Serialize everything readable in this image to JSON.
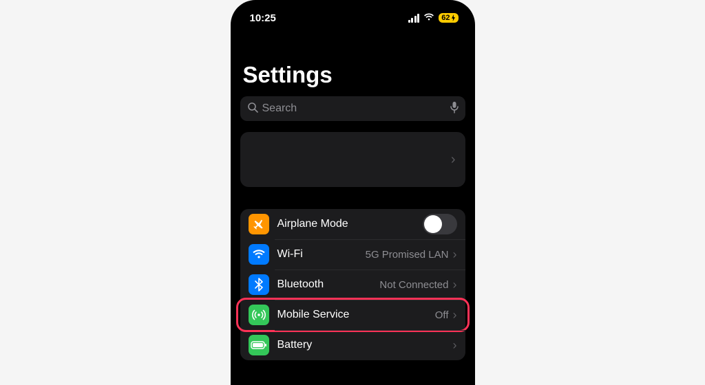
{
  "status": {
    "time": "10:25",
    "battery": "62"
  },
  "title": "Settings",
  "search": {
    "placeholder": "Search"
  },
  "rows": {
    "airplane": {
      "label": "Airplane Mode"
    },
    "wifi": {
      "label": "Wi-Fi",
      "detail": "5G Promised LAN"
    },
    "bluetooth": {
      "label": "Bluetooth",
      "detail": "Not Connected"
    },
    "mobile": {
      "label": "Mobile Service",
      "detail": "Off"
    },
    "battery": {
      "label": "Battery"
    }
  }
}
